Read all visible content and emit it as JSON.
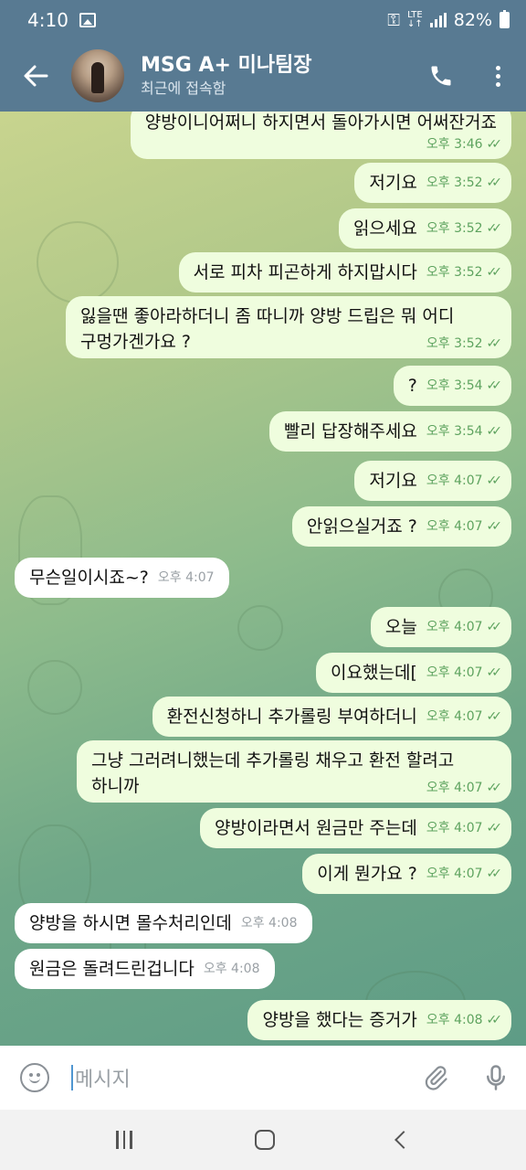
{
  "status_bar": {
    "time": "4:10",
    "network": "LTE",
    "battery": "82%"
  },
  "header": {
    "chat_name": "MSG A+ 미나팀장",
    "chat_status": "최근에 접속함"
  },
  "messages": [
    {
      "dir": "out",
      "text": "양방이니어쩌니 하지면서 돌아가시면 어써잔거죠",
      "time": "오후 3:46"
    },
    {
      "dir": "out",
      "text": "저기요",
      "time": "오후 3:52"
    },
    {
      "dir": "out",
      "text": "읽으세요",
      "time": "오후 3:52"
    },
    {
      "dir": "out",
      "text": "서로 피차 피곤하게 하지맙시다",
      "time": "오후 3:52"
    },
    {
      "dir": "out",
      "text": "잃을땐 좋아라하더니 좀 따니까 양방 드립은 뭐 어디",
      "text2": "구멍가겐가요 ?",
      "time": "오후 3:52"
    },
    {
      "dir": "out",
      "text": "?",
      "time": "오후 3:54"
    },
    {
      "dir": "out",
      "text": "빨리 답장해주세요",
      "time": "오후 3:54"
    },
    {
      "dir": "out",
      "text": "저기요",
      "time": "오후 4:07"
    },
    {
      "dir": "out",
      "text": "안읽으실거죠 ?",
      "time": "오후 4:07"
    },
    {
      "dir": "in",
      "text": "무슨일이시죠~?",
      "time": "오후 4:07"
    },
    {
      "dir": "out",
      "text": "오늘",
      "time": "오후 4:07"
    },
    {
      "dir": "out",
      "text": "이요했는데[",
      "time": "오후 4:07"
    },
    {
      "dir": "out",
      "text": "환전신청하니 추가롤링 부여하더니",
      "time": "오후 4:07"
    },
    {
      "dir": "out",
      "text": "그냥 그러려니했는데 추가롤링 채우고 환전 할려고",
      "text2": "하니까",
      "time": "오후 4:07"
    },
    {
      "dir": "out",
      "text": "양방이라면서 원금만 주는데",
      "time": "오후 4:07"
    },
    {
      "dir": "out",
      "text": "이게 뭔가요 ?",
      "time": "오후 4:07"
    },
    {
      "dir": "in",
      "text": "양방을 하시면 몰수처리인데",
      "time": "오후 4:08"
    },
    {
      "dir": "in",
      "text": "원금은 돌려드린겁니다",
      "time": "오후 4:08"
    },
    {
      "dir": "out",
      "text": "양방을 했다는 증거가",
      "time": "오후 4:08"
    }
  ],
  "composer": {
    "placeholder": "메시지"
  },
  "icons": {
    "back": "arrow-left-icon",
    "call": "phone-icon",
    "menu": "more-vertical-icon",
    "emoji": "emoji-icon",
    "attach": "paperclip-icon",
    "mic": "microphone-icon"
  }
}
